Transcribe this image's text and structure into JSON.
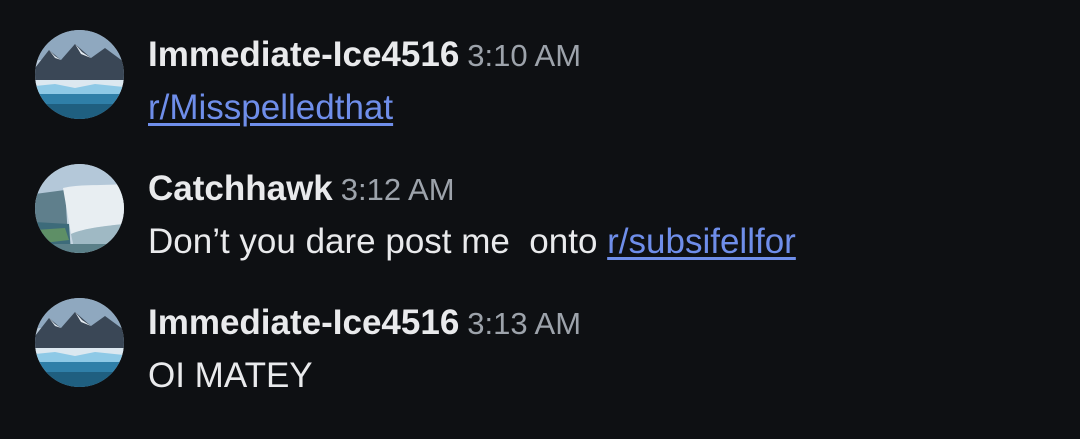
{
  "messages": [
    {
      "username": "Immediate-Ice4516",
      "time": "3:10 AM",
      "avatar_icon": "glacier-avatar",
      "text": "",
      "link": "r/Misspelledthat"
    },
    {
      "username": "Catchhawk",
      "time": "3:12 AM",
      "avatar_icon": "waterfall-avatar",
      "text": "Don’t you dare post me  onto ",
      "link": "r/subsifellfor"
    },
    {
      "username": "Immediate-Ice4516",
      "time": "3:13 AM",
      "avatar_icon": "glacier-avatar",
      "text": "OI MATEY",
      "link": ""
    }
  ],
  "colors": {
    "background": "#0e1013",
    "text": "#e9eaec",
    "timestamp": "#9da3ab",
    "link": "#6f8eea"
  }
}
